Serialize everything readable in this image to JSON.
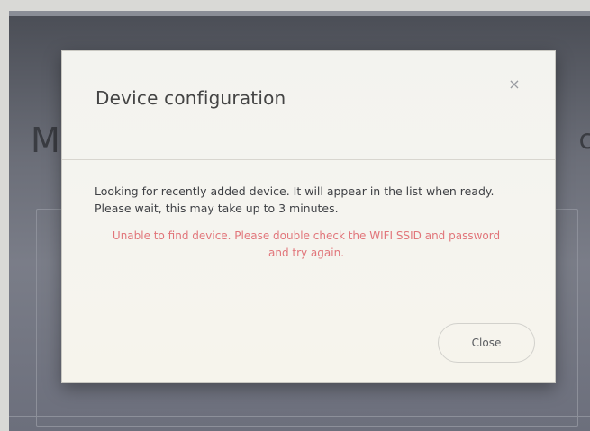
{
  "background_page": {
    "heading_fragment_left": "M",
    "heading_fragment_right": "c"
  },
  "dialog": {
    "title": "Device configuration",
    "close_icon": "×",
    "info_line_1": "Looking for recently added device. It will appear in the list when ready.",
    "info_line_2": "Please wait, this may take up to 3 minutes.",
    "error_line_1": "Unable to find device. Please double check the WIFI SSID and password",
    "error_line_2": "and try again.",
    "close_button_label": "Close"
  },
  "colors": {
    "error_text": "#e1757a",
    "dialog_background": "#f4f3ee",
    "backdrop": "#6b6e78"
  }
}
